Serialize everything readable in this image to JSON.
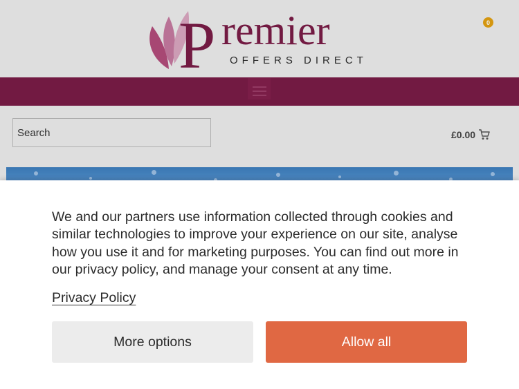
{
  "header": {
    "logo_word": "Premier",
    "logo_tagline": "OFFERS DIRECT"
  },
  "nav": {
    "menu_icon": "hamburger-menu-icon"
  },
  "search": {
    "placeholder": "Search"
  },
  "cart": {
    "total": "£0.00",
    "count": "0",
    "icon": "shopping-cart-icon"
  },
  "consent": {
    "message": "We and our partners use information collected through cookies and similar technologies to improve your experience on our site, analyse how you use it and for marketing purposes. You can find out more in our privacy policy, and manage your consent at any time.",
    "privacy_link": "Privacy Policy",
    "more_options": "More options",
    "allow_all": "Allow all"
  },
  "colors": {
    "brand": "#7a1c47",
    "header_bg": "#ececec",
    "accent_button": "#e06843",
    "cart_badge": "#e2a012"
  }
}
